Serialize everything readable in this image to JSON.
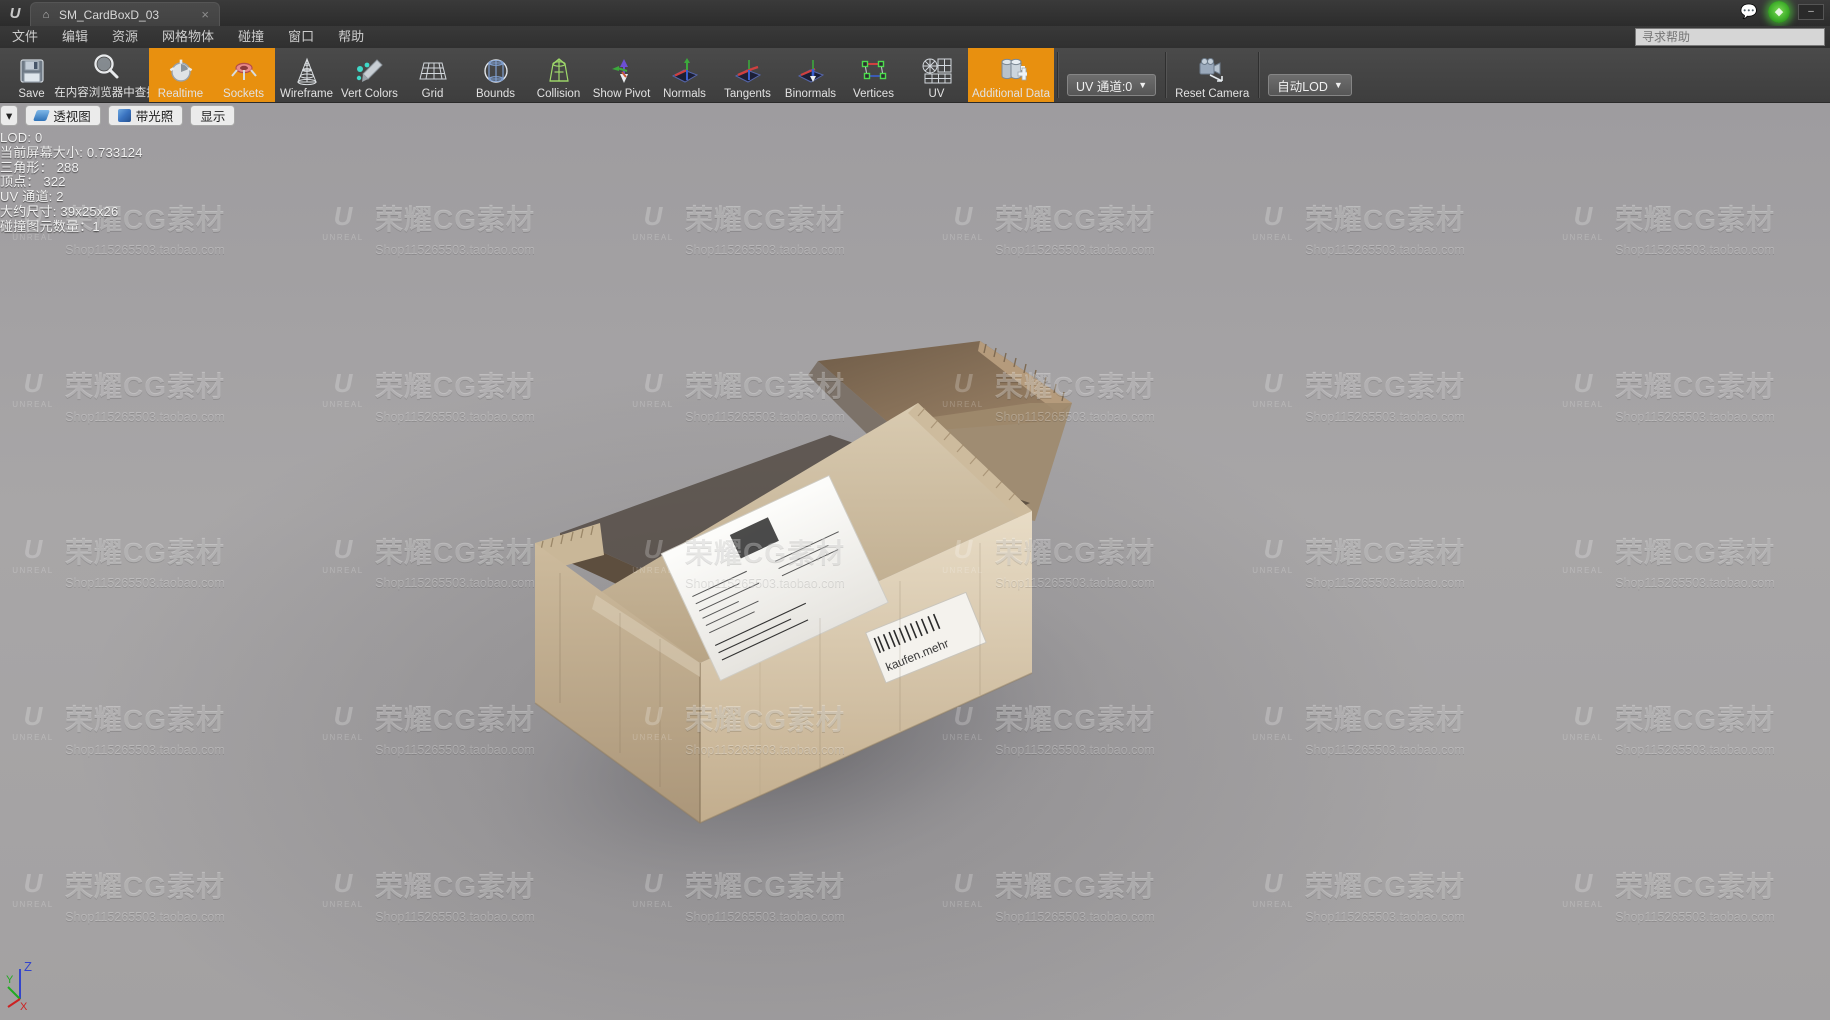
{
  "titlebar": {
    "logo": "ue-logo",
    "tab": {
      "label": "SM_CardBoxD_03",
      "icon": "home-icon",
      "close": "×"
    },
    "right_icons": [
      "message-icon",
      "ue-orb-icon"
    ],
    "window_button": "–"
  },
  "menubar": {
    "items": [
      "文件",
      "编辑",
      "资源",
      "网格物体",
      "碰撞",
      "窗口",
      "帮助"
    ],
    "search_placeholder": "寻求帮助"
  },
  "toolbar": {
    "buttons": [
      {
        "label": "Save",
        "icon": "save-icon",
        "active": false
      },
      {
        "label": "在内容浏览器中查找",
        "icon": "browse-icon",
        "active": false
      },
      {
        "label": "Realtime",
        "icon": "realtime-icon",
        "active": true
      },
      {
        "label": "Sockets",
        "icon": "sockets-icon",
        "active": true
      },
      {
        "label": "Wireframe",
        "icon": "wireframe-icon",
        "active": false
      },
      {
        "label": "Vert Colors",
        "icon": "vert-colors-icon",
        "active": false
      },
      {
        "label": "Grid",
        "icon": "grid-icon",
        "active": false
      },
      {
        "label": "Bounds",
        "icon": "bounds-icon",
        "active": false
      },
      {
        "label": "Collision",
        "icon": "collision-icon",
        "active": false
      },
      {
        "label": "Show Pivot",
        "icon": "show-pivot-icon",
        "active": false
      },
      {
        "label": "Normals",
        "icon": "normals-icon",
        "active": false
      },
      {
        "label": "Tangents",
        "icon": "tangents-icon",
        "active": false
      },
      {
        "label": "Binormals",
        "icon": "binormals-icon",
        "active": false
      },
      {
        "label": "Vertices",
        "icon": "vertices-icon",
        "active": false
      },
      {
        "label": "UV",
        "icon": "uv-icon",
        "active": false
      },
      {
        "label": "Additional Data",
        "icon": "additional-data-icon",
        "active": true
      }
    ],
    "uv_channel": "UV 通道:0",
    "reset_camera": "Reset Camera",
    "auto_lod": "自动LOD"
  },
  "viewport_toolbar": {
    "view_menu_arrow": "▾",
    "perspective": "透视图",
    "lit": "带光照",
    "show": "显示"
  },
  "stats": {
    "lod": "LOD: 0",
    "screen_size": "当前屏幕大小: 0.733124",
    "triangles": "三角形： 288",
    "vertices": "顶点： 322",
    "uv_channels": "UV 通道: 2",
    "approx_size": "大约尺寸: 39x25x26",
    "collision_prims": "碰撞图元数量：1"
  },
  "watermark": {
    "text": "荣耀CG素材",
    "url": "Shop115265503.taobao.com",
    "brand": "UNREAL",
    "brand_glyph": "U"
  },
  "gizmo": {
    "x": "X",
    "y": "Y",
    "z": "Z"
  },
  "colors": {
    "accent": "#e8900f",
    "toolbar_bg": "#443f3f",
    "viewport_bg": "#a5a3a4",
    "axis_x": "#cc2222",
    "axis_y": "#22aa22",
    "axis_z": "#3344cc"
  },
  "model": {
    "name": "cardboard-box-open",
    "label": "SM_CardBoxD_03"
  }
}
